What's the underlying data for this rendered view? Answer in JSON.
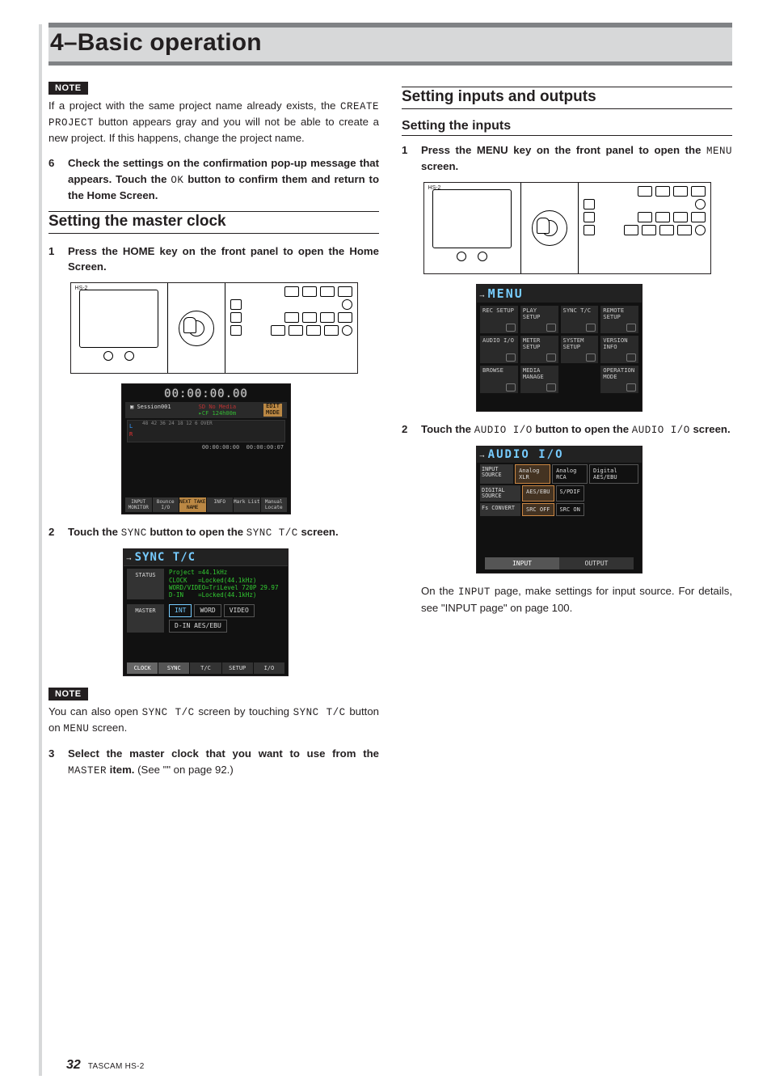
{
  "chapter": {
    "title": "4–Basic operation"
  },
  "note_label": "NOTE",
  "left": {
    "note1_a": "If a project with the same project name already exists, the ",
    "note1_mono": "CREATE PROJECT",
    "note1_b": " button appears gray and you will not be able to create a new project. If this happens, change the project name.",
    "step6_num": "6",
    "step6_a": "Check the settings on the confirmation pop-up message that appears. Touch the ",
    "step6_mono": "OK",
    "step6_b": " button to confirm them and return to the Home Screen.",
    "sec_master_clock": "Setting the master clock",
    "mc_step1_num": "1",
    "mc_step1": "Press the HOME key on the front panel to open the Home Screen.",
    "mc_step2_num": "2",
    "mc_step2_a": "Touch the ",
    "mc_step2_mono1": "SYNC",
    "mc_step2_b": " button to open the ",
    "mc_step2_mono2": "SYNC T/C",
    "mc_step2_c": " screen.",
    "note2_a": "You can also open ",
    "note2_mono1": "SYNC T/C",
    "note2_b": " screen by touching ",
    "note2_mono2": "SYNC T/C",
    "note2_c": " button on ",
    "note2_mono3": "MENU",
    "note2_d": " screen.",
    "mc_step3_num": "3",
    "mc_step3_a": "Select the master clock that you want to use from the ",
    "mc_step3_mono": "MASTER",
    "mc_step3_b": " item.",
    "mc_step3_ref": " (See \"\" on page 92.)"
  },
  "right": {
    "sec_io": "Setting inputs and outputs",
    "sub_inputs": "Setting the inputs",
    "in_step1_num": "1",
    "in_step1_a": "Press the MENU key on the front panel to open the ",
    "in_step1_mono": "MENU",
    "in_step1_b": " screen.",
    "in_step2_num": "2",
    "in_step2_a": "Touch the ",
    "in_step2_mono1": "AUDIO I/O",
    "in_step2_b": " button to open the ",
    "in_step2_mono2": "AUDIO I/O",
    "in_step2_c": " screen.",
    "in_after_a": "On the ",
    "in_after_mono": "INPUT",
    "in_after_b": " page, make settings for input source. For details, see \"INPUT page\" on page 100."
  },
  "lcd_home": {
    "time": "00:00:00.00",
    "session": "Session001",
    "media": "SD No Media",
    "cf": "CF 124h00m",
    "mode_top": "EDIT",
    "mode_bot": "MODE",
    "scale": "48 42 36 24 18 12 6 OVER",
    "t1": "00:00:00:00",
    "t2": "00:00:00:07",
    "btns": [
      "INPUT MONITOR",
      "Bounce I/O",
      "NEXT TAKE NAME",
      "INFO",
      "Mark List",
      "Manual Locate"
    ]
  },
  "lcd_sync": {
    "title": "SYNC T/C",
    "status_label": "STATUS",
    "status_lines": "Project =44.1kHz\nCLOCK   =Locked(44.1kHz)\nWORD/VIDEO=TriLevel 720P 29.97\nD-IN    =Locked(44.1kHz)",
    "master_label": "MASTER",
    "opts": [
      "INT",
      "WORD",
      "VIDEO"
    ],
    "opt_din": "D-IN AES/EBU",
    "clock_label": "CLOCK",
    "tabs": [
      "SYNC",
      "T/C",
      "SETUP",
      "I/O"
    ]
  },
  "lcd_menu": {
    "title": "MENU",
    "cells": [
      "REC SETUP",
      "PLAY SETUP",
      "SYNC T/C",
      "REMOTE SETUP",
      "AUDIO I/O",
      "METER SETUP",
      "SYSTEM SETUP",
      "VERSION INFO",
      "BROWSE",
      "MEDIA MANAGE",
      "",
      "OPERATION MODE"
    ]
  },
  "lcd_aio": {
    "title": "AUDIO I/O",
    "rows": [
      {
        "lab": "INPUT SOURCE",
        "opts": [
          "Analog XLR",
          "Analog RCA",
          "Digital AES/EBU"
        ],
        "sel": 0
      },
      {
        "lab": "DIGITAL SOURCE",
        "opts": [
          "AES/EBU",
          "S/PDIF"
        ],
        "sel": 0
      },
      {
        "lab": "Fs CONVERT",
        "opts": [
          "SRC OFF",
          "SRC ON"
        ],
        "sel": 0
      }
    ],
    "tabs": [
      "INPUT",
      "OUTPUT"
    ]
  },
  "device_label": "HS-2",
  "footer": {
    "page": "32",
    "model": "TASCAM HS-2"
  }
}
